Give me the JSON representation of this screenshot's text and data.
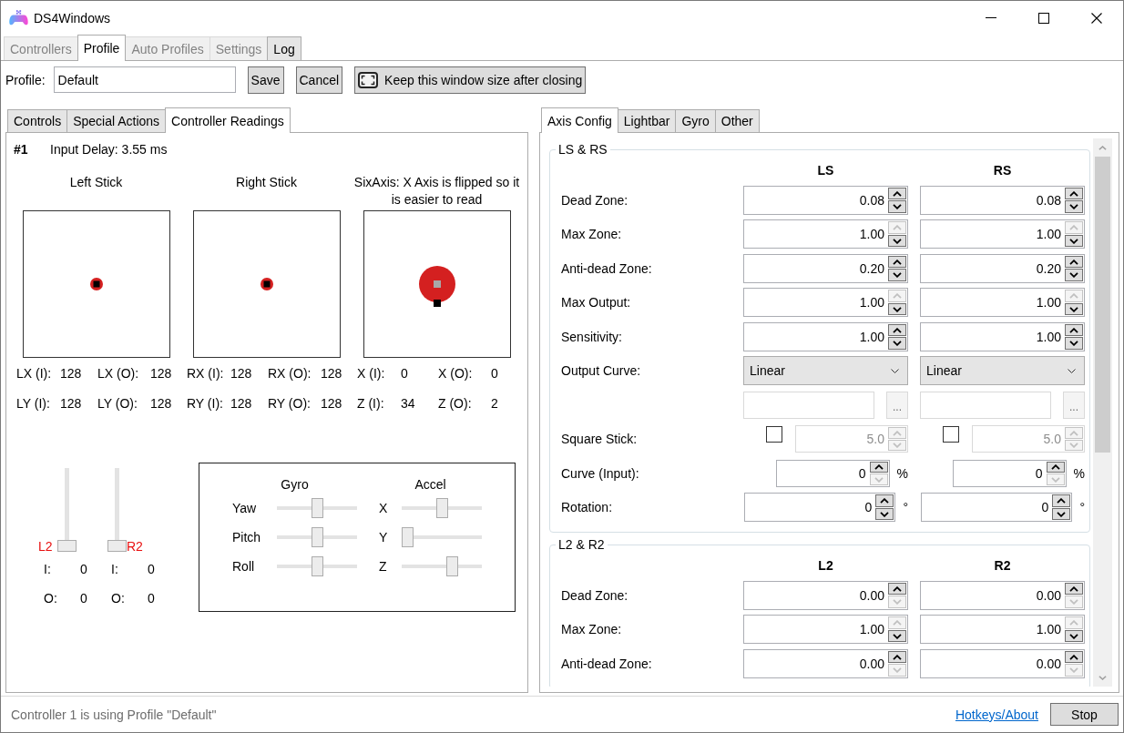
{
  "window": {
    "title": "DS4Windows"
  },
  "main_tabs": [
    {
      "label": "Controllers",
      "selected": false,
      "disabled": true
    },
    {
      "label": "Profile",
      "selected": true,
      "disabled": false
    },
    {
      "label": "Auto Profiles",
      "selected": false,
      "disabled": true
    },
    {
      "label": "Settings",
      "selected": false,
      "disabled": true
    },
    {
      "label": "Log",
      "selected": false,
      "disabled": false
    }
  ],
  "profile_bar": {
    "label": "Profile:",
    "value": "Default",
    "buttons": [
      {
        "label": "Save",
        "kind": "text"
      },
      {
        "label": "Cancel",
        "kind": "text"
      },
      {
        "label": "Keep this window size after closing",
        "kind": "icon"
      }
    ]
  },
  "readings_panel": {
    "tabs": [
      {
        "label": "Controls",
        "selected": false
      },
      {
        "label": "Special Actions",
        "selected": false
      },
      {
        "label": "Controller Readings",
        "selected": true
      }
    ],
    "controller": "#1",
    "input_delay": "Input Delay: 3.55 ms",
    "sticks": [
      {
        "kind": "stick",
        "title": "Left Stick",
        "readings": [
          {
            "label": "LX (I):",
            "value": "128"
          },
          {
            "label": "LX (O):",
            "value": "128"
          },
          {
            "label": "LY (I):",
            "value": "128"
          },
          {
            "label": "LY (O):",
            "value": "128"
          }
        ]
      },
      {
        "kind": "stick",
        "title": "Right Stick",
        "readings": [
          {
            "label": "RX (I):",
            "value": "128"
          },
          {
            "label": "RX (O):",
            "value": "128"
          },
          {
            "label": "RY (I):",
            "value": "128"
          },
          {
            "label": "RY (O):",
            "value": "128"
          }
        ]
      },
      {
        "kind": "sixaxis",
        "title": "SixAxis: X Axis is flipped so it is easier to read",
        "readings": [
          {
            "label": "X (I):",
            "value": "0"
          },
          {
            "label": "X (O):",
            "value": "0"
          },
          {
            "label": "Z (I):",
            "value": "34"
          },
          {
            "label": "Z (O):",
            "value": "2"
          }
        ]
      }
    ],
    "triggers": [
      {
        "label": "L2",
        "level": 0,
        "readings": [
          {
            "label": "I:",
            "value": "0"
          },
          {
            "label": "O:",
            "value": "0"
          }
        ]
      },
      {
        "label": "R2",
        "level": 0,
        "readings": [
          {
            "label": "I:",
            "value": "0"
          },
          {
            "label": "O:",
            "value": "0"
          }
        ]
      }
    ],
    "motion": {
      "groups": [
        {
          "title": "Gyro",
          "axes": [
            {
              "label": "Yaw",
              "level": 0.5
            },
            {
              "label": "Pitch",
              "level": 0.5
            },
            {
              "label": "Roll",
              "level": 0.5
            }
          ]
        },
        {
          "title": "Accel",
          "axes": [
            {
              "label": "X",
              "level": 0.5
            },
            {
              "label": "Y",
              "level": 0
            },
            {
              "label": "Z",
              "level": 0.65
            }
          ]
        }
      ]
    }
  },
  "config_panel": {
    "tabs": [
      {
        "label": "Axis Config",
        "selected": true
      },
      {
        "label": "Lightbar",
        "selected": false
      },
      {
        "label": "Gyro",
        "selected": false
      },
      {
        "label": "Other",
        "selected": false
      }
    ],
    "groups": [
      {
        "title": "LS & RS",
        "columns": [
          "LS",
          "RS"
        ],
        "rows": [
          {
            "kind": "spin",
            "label": "Dead Zone:",
            "cells": [
              {
                "value": "0.08",
                "up_disabled": false,
                "down_disabled": false
              },
              {
                "value": "0.08",
                "up_disabled": false,
                "down_disabled": false
              }
            ]
          },
          {
            "kind": "spin",
            "label": "Max Zone:",
            "cells": [
              {
                "value": "1.00",
                "up_disabled": true,
                "down_disabled": false
              },
              {
                "value": "1.00",
                "up_disabled": true,
                "down_disabled": false
              }
            ]
          },
          {
            "kind": "spin",
            "label": "Anti-dead Zone:",
            "cells": [
              {
                "value": "0.20",
                "up_disabled": false,
                "down_disabled": false
              },
              {
                "value": "0.20",
                "up_disabled": false,
                "down_disabled": false
              }
            ]
          },
          {
            "kind": "spin",
            "label": "Max Output:",
            "cells": [
              {
                "value": "1.00",
                "up_disabled": true,
                "down_disabled": false
              },
              {
                "value": "1.00",
                "up_disabled": true,
                "down_disabled": false
              }
            ]
          },
          {
            "kind": "spin",
            "label": "Sensitivity:",
            "cells": [
              {
                "value": "1.00",
                "up_disabled": false,
                "down_disabled": false
              },
              {
                "value": "1.00",
                "up_disabled": false,
                "down_disabled": false
              }
            ]
          },
          {
            "kind": "dropdown",
            "label": "Output Curve:",
            "cells": [
              {
                "value": "Linear"
              },
              {
                "value": "Linear"
              }
            ]
          },
          {
            "kind": "custom_curve",
            "cells": [
              {
                "button": "..."
              },
              {
                "button": "..."
              }
            ]
          },
          {
            "kind": "check_spin",
            "label": "Square Stick:",
            "cells": [
              {
                "checked": false,
                "value": "5.0",
                "disabled": true,
                "up_disabled": true,
                "down_disabled": true
              },
              {
                "checked": false,
                "value": "5.0",
                "disabled": true,
                "up_disabled": true,
                "down_disabled": true
              }
            ]
          },
          {
            "kind": "unit_spin",
            "label": "Curve (Input):",
            "cells": [
              {
                "value": "0",
                "unit": "%",
                "up_disabled": false,
                "down_disabled": true
              },
              {
                "value": "0",
                "unit": "%",
                "up_disabled": false,
                "down_disabled": true
              }
            ]
          },
          {
            "kind": "wide_unit_spin",
            "label": "Rotation:",
            "cells": [
              {
                "value": "0",
                "unit": "°",
                "up_disabled": false,
                "down_disabled": false
              },
              {
                "value": "0",
                "unit": "°",
                "up_disabled": false,
                "down_disabled": false
              }
            ]
          }
        ]
      },
      {
        "title": "L2 & R2",
        "columns": [
          "L2",
          "R2"
        ],
        "rows": [
          {
            "kind": "spin",
            "label": "Dead Zone:",
            "cells": [
              {
                "value": "0.00",
                "up_disabled": false,
                "down_disabled": true
              },
              {
                "value": "0.00",
                "up_disabled": false,
                "down_disabled": true
              }
            ]
          },
          {
            "kind": "spin",
            "label": "Max Zone:",
            "cells": [
              {
                "value": "1.00",
                "up_disabled": true,
                "down_disabled": false
              },
              {
                "value": "1.00",
                "up_disabled": true,
                "down_disabled": false
              }
            ]
          },
          {
            "kind": "spin",
            "label": "Anti-dead Zone:",
            "cells": [
              {
                "value": "0.00",
                "up_disabled": false,
                "down_disabled": true
              },
              {
                "value": "0.00",
                "up_disabled": false,
                "down_disabled": true
              }
            ]
          }
        ]
      }
    ]
  },
  "status_bar": {
    "message": "Controller 1 is using Profile \"Default\"",
    "link": "Hotkeys/About",
    "button": "Stop"
  }
}
